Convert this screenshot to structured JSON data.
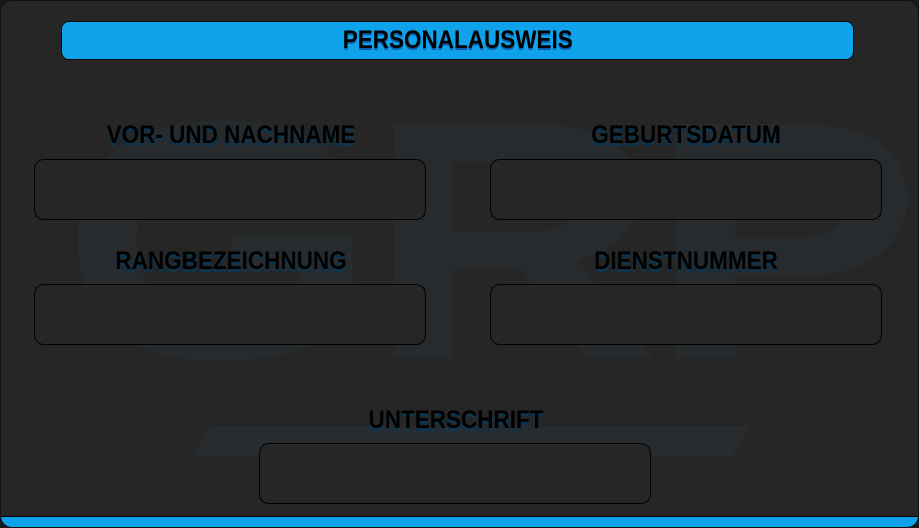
{
  "title": "PERSONALAUSWEIS",
  "watermark": "GRP",
  "fields": [
    {
      "label": "VOR- UND NACHNAME",
      "value": ""
    },
    {
      "label": "GEBURTSDATUM",
      "value": ""
    },
    {
      "label": "RANGBEZEICHNUNG",
      "value": ""
    },
    {
      "label": "DIENSTNUMMER",
      "value": ""
    },
    {
      "label": "UNTERSCHRIFT",
      "value": ""
    }
  ],
  "colors": {
    "accent": "#0ea2ea",
    "background": "#262626"
  }
}
